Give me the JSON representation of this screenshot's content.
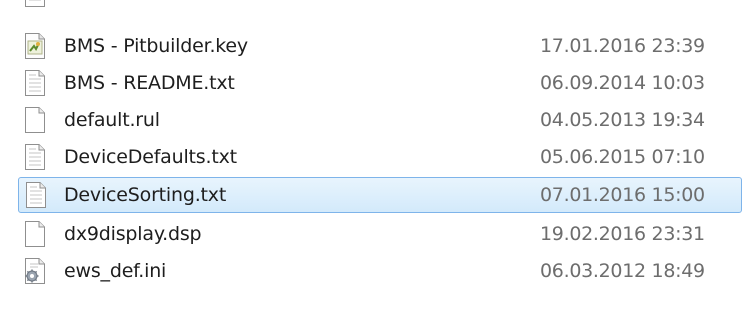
{
  "files": [
    {
      "name": "BMS - Pitbuilder.key",
      "date": "17.01.2016 23:39",
      "icon": "key-file-icon",
      "selected": false
    },
    {
      "name": "BMS - README.txt",
      "date": "06.09.2014 10:03",
      "icon": "text-file-icon",
      "selected": false
    },
    {
      "name": "default.rul",
      "date": "04.05.2013 19:34",
      "icon": "blank-file-icon",
      "selected": false
    },
    {
      "name": "DeviceDefaults.txt",
      "date": "05.06.2015 07:10",
      "icon": "text-file-icon",
      "selected": false
    },
    {
      "name": "DeviceSorting.txt",
      "date": "07.01.2016 15:00",
      "icon": "text-file-icon",
      "selected": true
    },
    {
      "name": "dx9display.dsp",
      "date": "19.02.2016 23:31",
      "icon": "blank-file-icon",
      "selected": false
    },
    {
      "name": "ews_def.ini",
      "date": "06.03.2012 18:49",
      "icon": "settings-file-icon",
      "selected": false
    }
  ],
  "colors": {
    "selection_fill": "#d3eafb",
    "selection_border": "#7eb4ea",
    "name_text": "#1e1e1e",
    "date_text": "#6d6d6d"
  }
}
